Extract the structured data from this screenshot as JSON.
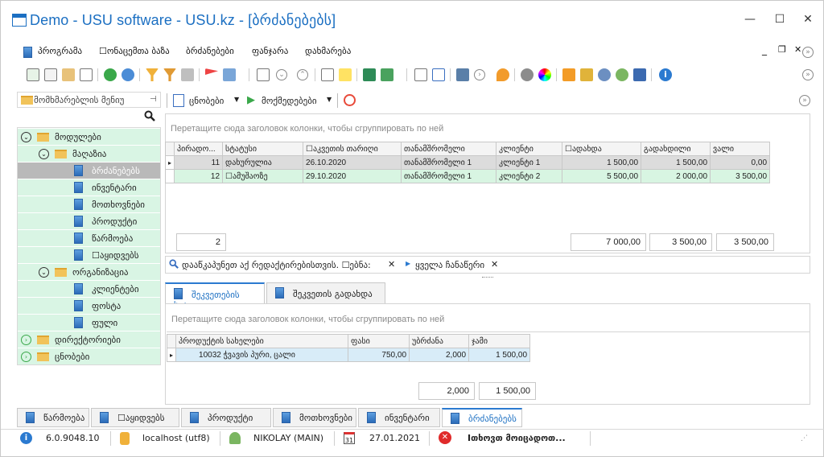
{
  "window": {
    "title": "Demo - USU software - USU.kz - [ბრძანებებს]",
    "minimize": "—",
    "maximize": "☐",
    "close": "✕"
  },
  "menu": {
    "items": [
      "პროგრამა",
      "☐ონაცემთა ბაზა",
      "ბრძანებები",
      "ფანჯარა",
      "დახმარება"
    ]
  },
  "sidebar": {
    "title": "მომხმარებლის მენიუ",
    "tree": [
      {
        "label": "მოდულები",
        "level": 0,
        "kind": "folder",
        "expanded": true
      },
      {
        "label": "მაღაზია",
        "level": 1,
        "kind": "folder",
        "expanded": true
      },
      {
        "label": "ბრძანებებს",
        "level": 2,
        "kind": "leaf",
        "selected": true
      },
      {
        "label": "ინვენტარი",
        "level": 2,
        "kind": "leaf"
      },
      {
        "label": "მოთხოვნები",
        "level": 2,
        "kind": "leaf"
      },
      {
        "label": "პროდუქტი",
        "level": 2,
        "kind": "leaf"
      },
      {
        "label": "წარმოება",
        "level": 2,
        "kind": "leaf"
      },
      {
        "label": "☐აყიდვებს",
        "level": 2,
        "kind": "leaf"
      },
      {
        "label": "ორგანიზაცია",
        "level": 1,
        "kind": "folder",
        "expanded": true
      },
      {
        "label": "კლიენტები",
        "level": 2,
        "kind": "leaf"
      },
      {
        "label": "ფოსტა",
        "level": 2,
        "kind": "leaf"
      },
      {
        "label": "ფული",
        "level": 2,
        "kind": "leaf"
      },
      {
        "label": "დირექტორიები",
        "level": 0,
        "kind": "folder",
        "expanded": false
      },
      {
        "label": "ცნობები",
        "level": 0,
        "kind": "folder",
        "expanded": false
      }
    ]
  },
  "content_toolbar": {
    "reports": "ცნობები",
    "actions": "მოქმედებები"
  },
  "orders_grid": {
    "group_hint": "Перетащите сюда заголовок колонки, чтобы сгруппировать по ней",
    "columns": [
      "პირადო...",
      "სტატუსი",
      "☐აკვეთის თარიღი",
      "თანამშრომელი",
      "კლიენტი",
      "☐ადახდა",
      "გადახდილი",
      "ვალი"
    ],
    "rows": [
      [
        "11",
        "დახურულია",
        "26.10.2020",
        "თანამშრომელი 1",
        "კლიენტი 1",
        "1 500,00",
        "1 500,00",
        "0,00"
      ],
      [
        "12",
        "☐ამუშაოზე",
        "29.10.2020",
        "თანამშრომელი 1",
        "კლიენტი 2",
        "5 500,00",
        "2 000,00",
        "3 500,00"
      ]
    ],
    "totals": {
      "count": "2",
      "sum": "7 000,00",
      "paid": "3 500,00",
      "debt": "3 500,00"
    }
  },
  "filter_bar": {
    "hint": "დააწკაპუნეთ აქ რედაქტირებისთვის. ☐ებნა:",
    "all_records": "ყველა ჩანაწერი"
  },
  "detail_tabs": [
    "შეკვეთების სია",
    "შეკვეთის გადახდა"
  ],
  "detail_grid": {
    "group_hint": "Перетащите сюда заголовок колонки, чтобы сгруппировать по ней",
    "columns": [
      "პროდუქტის სახელები",
      "ფასი",
      "უბრძანა",
      "ჯამი"
    ],
    "rows": [
      [
        "10032 ჭვავის პური, ცალი",
        "750,00",
        "2,000",
        "1 500,00"
      ]
    ],
    "totals": {
      "qty": "2,000",
      "sum": "1 500,00"
    }
  },
  "bottom_tabs": [
    "წარმოება",
    "☐აყიდვებს",
    "პროდუქტი",
    "მოთხოვნები",
    "ინვენტარი",
    "ბრძანებებს"
  ],
  "status": {
    "version": "6.0.9048.10",
    "db": "localhost (utf8)",
    "user": "NIKOLAY (MAIN)",
    "calendar_day": "31",
    "date": "27.01.2021",
    "message": "Iთხოვთ მოიცადოთ..."
  },
  "colors": {
    "accent": "#1b6fc2",
    "tree_bg": "#d9f5e4",
    "selected": "#b9b9b9",
    "green_row": "#d8f5e2"
  }
}
